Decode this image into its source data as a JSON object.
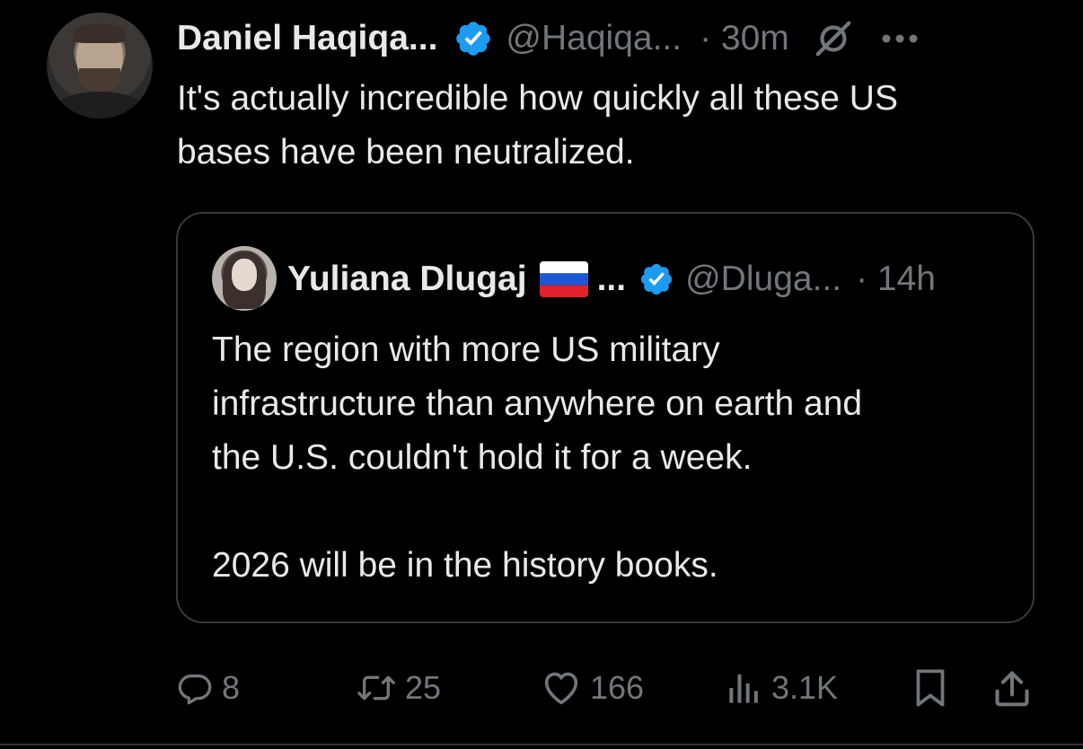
{
  "colors": {
    "background": "#000000",
    "text_primary": "#e7e9ea",
    "text_secondary": "#71767b",
    "verified_blue": "#1d9bf0",
    "border": "#38393b"
  },
  "tweet": {
    "author_name": "Daniel Haqiqa...",
    "verified_icon": "verified-badge-icon",
    "handle": "@Haqiqa...",
    "time": "· 30m",
    "grok_icon": "grok-icon",
    "more_icon": "more-icon",
    "text": "It's actually incredible how quickly all these US\nbases have been neutralized."
  },
  "quote": {
    "author_name": "Yuliana Dlugaj",
    "flag_icon": "russia-flag-icon",
    "name_ellipsis": "...",
    "verified_icon": "verified-badge-icon",
    "handle": "@Dluga...",
    "time": "· 14h",
    "text": "The region with more US military\ninfrastructure than anywhere on earth and\nthe U.S. couldn't hold it for a week.\n\n2026 will be in the history books."
  },
  "actions": {
    "replies": "8",
    "reposts": "25",
    "likes": "166",
    "views": "3.1K",
    "bookmark_icon": "bookmark-icon",
    "share_icon": "share-icon"
  }
}
